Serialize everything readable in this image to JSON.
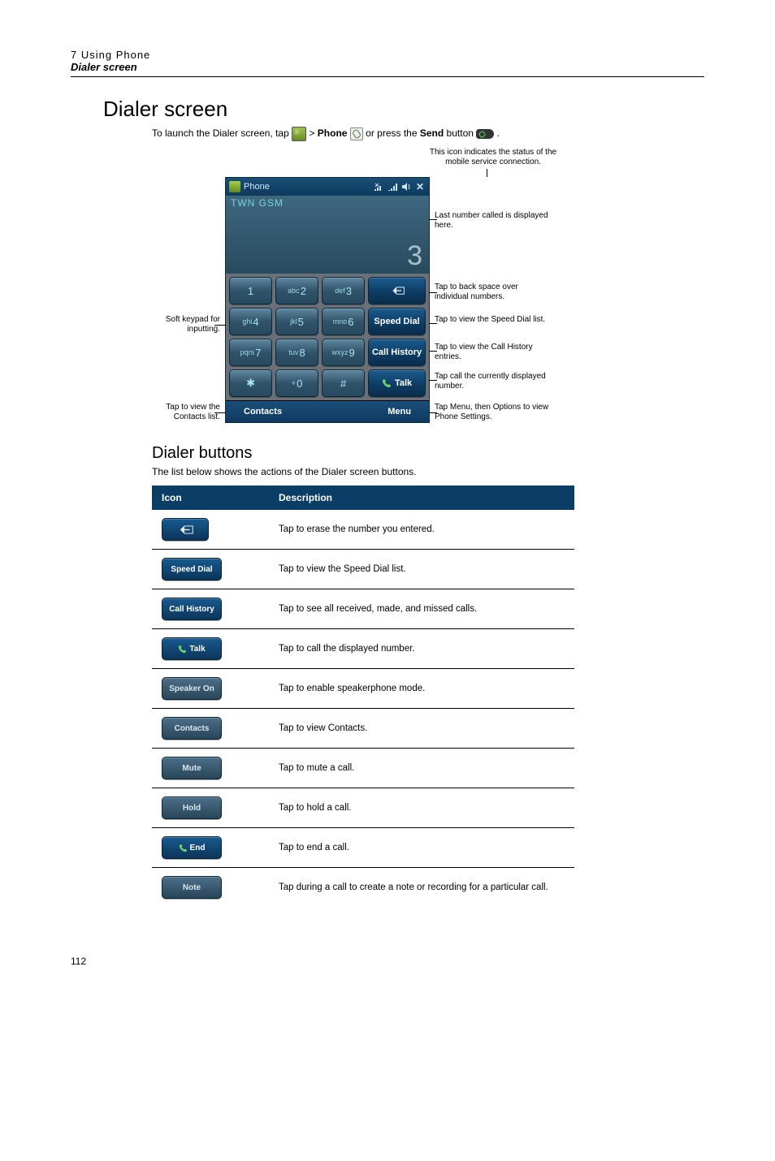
{
  "header": {
    "chapter": "7 Using Phone",
    "subtitle": "Dialer screen"
  },
  "section": {
    "title": "Dialer screen",
    "launch_pre": "To launch the Dialer screen, tap ",
    "launch_mid1": " > ",
    "launch_phone_word": "Phone",
    "launch_mid2": "  or press the ",
    "launch_send_word": "Send",
    "launch_post": " button ",
    "launch_end": "."
  },
  "mobile": {
    "status_note": "This icon indicates the status of the mobile service connection.",
    "title": "Phone",
    "carrier": "TWN GSM",
    "display_number": "3",
    "keys": {
      "k1": "1",
      "k2p": "abc",
      "k2": "2",
      "k3p": "def",
      "k3": "3",
      "k4p": "ghi",
      "k4": "4",
      "k5p": "jkl",
      "k5": "5",
      "k6p": "mno",
      "k6": "6",
      "k7p": "pqrs",
      "k7": "7",
      "k8p": "tuv",
      "k8": "8",
      "k9p": "wxyz",
      "k9": "9",
      "kstar": "✱",
      "k0p": "+",
      "k0": "0",
      "khash": "#"
    },
    "actions": {
      "speed_dial": "Speed Dial",
      "call_history": "Call History",
      "talk": "Talk"
    },
    "bottom": {
      "contacts": "Contacts",
      "menu": "Menu"
    }
  },
  "callouts": {
    "left_keypad": "Soft keypad for inputting.",
    "left_contacts": "Tap to view the Contacts list.",
    "right_lastnum": "Last number called is displayed here.",
    "right_backspace": "Tap to back space over individual numbers.",
    "right_speed": "Tap to view the Speed Dial list.",
    "right_history": "Tap to view the Call History entries.",
    "right_talk": "Tap call the currently displayed number.",
    "right_menu": "Tap Menu, then Options to view Phone Settings."
  },
  "buttons_section": {
    "title": "Dialer buttons",
    "intro": "The list below shows the actions of the Dialer screen buttons.",
    "head_icon": "Icon",
    "head_desc": "Description",
    "rows": [
      {
        "label": "",
        "style": "darkblue",
        "kind": "bs",
        "desc": "Tap to erase the number you entered."
      },
      {
        "label": "Speed Dial",
        "style": "darkblue",
        "kind": "text",
        "desc": "Tap to view the Speed Dial list."
      },
      {
        "label": "Call History",
        "style": "darkblue",
        "kind": "text",
        "desc": "Tap to see all received, made, and missed calls."
      },
      {
        "label": "Talk",
        "style": "darkblue",
        "kind": "phone",
        "desc": "Tap to call the displayed number."
      },
      {
        "label": "Speaker On",
        "style": "steel",
        "kind": "text",
        "desc": "Tap to enable speakerphone mode."
      },
      {
        "label": "Contacts",
        "style": "steel",
        "kind": "text",
        "desc": "Tap to view Contacts."
      },
      {
        "label": "Mute",
        "style": "steel",
        "kind": "text",
        "desc": "Tap to mute a call."
      },
      {
        "label": "Hold",
        "style": "steel",
        "kind": "text",
        "desc": "Tap to hold a call."
      },
      {
        "label": "End",
        "style": "darkblue",
        "kind": "phone",
        "desc": "Tap to end a call."
      },
      {
        "label": "Note",
        "style": "steel",
        "kind": "text",
        "desc": "Tap during a call to create a note or recording for a particular call."
      }
    ]
  },
  "page_number": "112"
}
